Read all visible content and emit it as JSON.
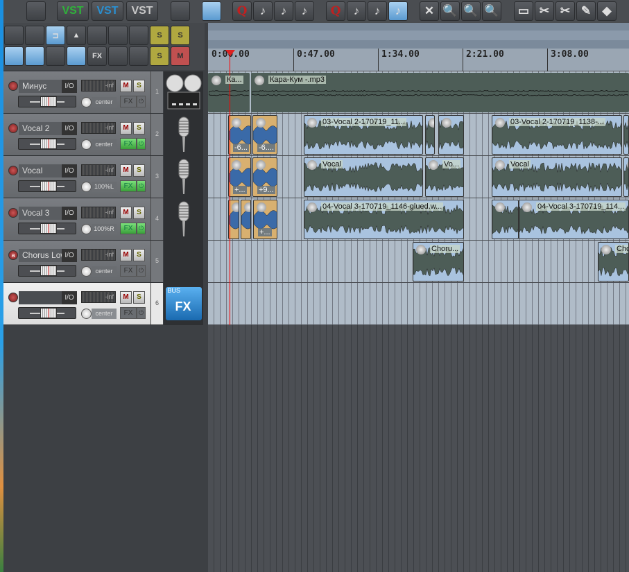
{
  "toolbar_top": [
    {
      "icon": "cpu-info-icon",
      "label": ""
    },
    {
      "icon": "vst-green-icon",
      "label": "VST",
      "color": "#2fb33a"
    },
    {
      "icon": "vst-blue-icon",
      "label": "VST",
      "color": "#2a8fd0"
    },
    {
      "icon": "vst-gray-icon",
      "label": "VST",
      "color": "#c8c8c8"
    },
    {
      "icon": "clapperboard-icon",
      "label": ""
    },
    {
      "icon": "walking-people-icon",
      "label": ""
    },
    {
      "icon": "quantize-icon",
      "label": "Q",
      "color": "#c02020"
    },
    {
      "icon": "note-icon",
      "label": "♪"
    },
    {
      "icon": "note-icon",
      "label": "♪"
    },
    {
      "icon": "note-icon",
      "label": "♪"
    },
    {
      "icon": "quantize-icon",
      "label": "Q",
      "color": "#c02020"
    },
    {
      "icon": "note-grid-icon",
      "label": "♪"
    },
    {
      "icon": "note-grid-icon",
      "label": "♪"
    },
    {
      "icon": "note-grid-icon",
      "label": "♪"
    },
    {
      "icon": "zoom-fit-icon",
      "label": "✕"
    },
    {
      "icon": "zoom-a-icon",
      "label": "🔍"
    },
    {
      "icon": "zoom-green-icon",
      "label": "🔍"
    },
    {
      "icon": "zoom-undo-icon",
      "label": "🔍"
    },
    {
      "icon": "razor-icon",
      "label": "▭"
    },
    {
      "icon": "scissors-icon",
      "label": "✂"
    },
    {
      "icon": "scissors-icon",
      "label": "✂"
    },
    {
      "icon": "pencil-icon",
      "label": "✎"
    },
    {
      "icon": "eraser-icon",
      "label": "◆"
    }
  ],
  "toolbar_left": [
    {
      "icon": "speech-bubble-icon",
      "label": ""
    },
    {
      "icon": "snap-icon",
      "label": ""
    },
    {
      "icon": "magnet-icon",
      "label": "⊐"
    },
    {
      "icon": "metronome-icon",
      "label": "▲"
    },
    {
      "icon": "folder-move-icon",
      "label": ""
    },
    {
      "icon": "folder-eye-icon",
      "label": ""
    },
    {
      "icon": "folder-icon",
      "label": ""
    },
    {
      "icon": "solo-d-icon",
      "label": "S"
    },
    {
      "icon": "solo-clear-icon",
      "label": "S"
    },
    {
      "icon": "envelope-icon",
      "label": ""
    },
    {
      "icon": "ripple-icon",
      "label": ""
    },
    {
      "icon": "ripple-all-icon",
      "label": ""
    },
    {
      "icon": "ruler-icon",
      "label": ""
    },
    {
      "icon": "fx-remove-icon",
      "label": "FX"
    },
    {
      "icon": "folder-green-icon",
      "label": ""
    },
    {
      "icon": "folder-icon",
      "label": ""
    },
    {
      "icon": "solo-a-icon",
      "label": "S"
    },
    {
      "icon": "mute-clear-icon",
      "label": "M"
    }
  ],
  "ruler": {
    "labels": [
      "0:00.00",
      "0:47.00",
      "1:34.00",
      "2:21.00",
      "3:08.00"
    ]
  },
  "tracks": [
    {
      "number": "1",
      "name": "Минус",
      "rec": "",
      "meter": "-inf",
      "pan": "center",
      "fx_active": false,
      "icon": "tape-recorder-icon"
    },
    {
      "number": "2",
      "name": "Vocal 2",
      "rec": "",
      "meter": "-inf",
      "pan": "center",
      "fx_active": true,
      "icon": "microphone-icon"
    },
    {
      "number": "3",
      "name": "Vocal",
      "rec": "",
      "meter": "-inf",
      "pan": "100%L",
      "fx_active": true,
      "icon": "microphone-icon"
    },
    {
      "number": "4",
      "name": "Vocal 3",
      "rec": "",
      "meter": "-inf",
      "pan": "100%R",
      "fx_active": true,
      "icon": "microphone-icon"
    },
    {
      "number": "5",
      "name": "Chorus Low",
      "rec": "a",
      "meter": "-inf",
      "pan": "center",
      "fx_active": false,
      "icon": "empty"
    },
    {
      "number": "6",
      "name": "",
      "rec": "",
      "meter": "-inf",
      "pan": "center",
      "fx_active": false,
      "icon": "bus-fx-folder-icon",
      "icon_text": [
        "BUS",
        "FX"
      ],
      "selected": true
    }
  ],
  "labels": {
    "io": "I/O",
    "mute": "M",
    "solo": "S",
    "fx": "FX",
    "power": "⏻"
  },
  "items": {
    "t1": [
      {
        "label": "Ка..."
      },
      {
        "label": "Кара-Кум -.mp3"
      }
    ],
    "t2": [
      {
        "label": "",
        "bottom": "-6..."
      },
      {
        "label": "",
        "bottom": "-6...."
      },
      {
        "label": "03-Vocal 2-170719_11..."
      },
      {
        "label": ""
      },
      {
        "label": ""
      },
      {
        "label": "03-Vocal 2-170719_1138-..."
      },
      {
        "label": ""
      }
    ],
    "t3": [
      {
        "label": "",
        "bottom": "+..."
      },
      {
        "label": "",
        "bottom": "+9..."
      },
      {
        "label": "Vocal"
      },
      {
        "label": "Vo..."
      },
      {
        "label": "Vocal"
      },
      {
        "label": ""
      }
    ],
    "t4": [
      {
        "label": ""
      },
      {
        "label": ""
      },
      {
        "label": "",
        "bottom": "+..."
      },
      {
        "label": "04-Vocal 3-170719_1146-glued.w..."
      },
      {
        "label": ""
      },
      {
        "label": "04-Vocal 3-170719_114..."
      }
    ],
    "t5": [
      {
        "label": "Choru..."
      },
      {
        "label": "Chor"
      }
    ]
  },
  "colors": {
    "accent": "#5a9ad0",
    "fx_on": "#3aa03a",
    "playhead": "#ff0000",
    "item": "#a9c3df",
    "item_orange": "#d8b070"
  }
}
